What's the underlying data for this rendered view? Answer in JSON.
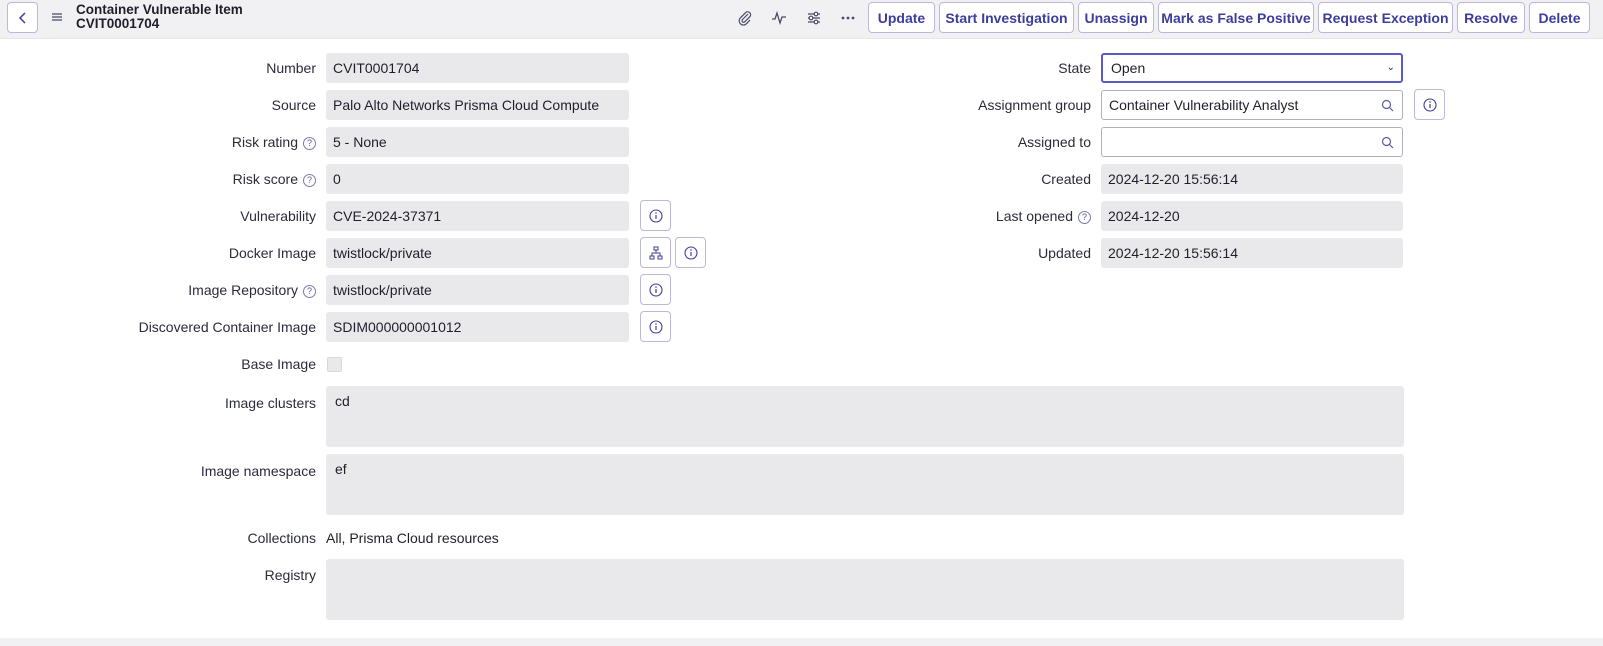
{
  "header": {
    "title": "Container Vulnerable Item",
    "number": "CVIT0001704",
    "icons": [
      "back-icon",
      "menu-icon",
      "paperclip-icon",
      "activity-icon",
      "sliders-icon",
      "more-icon"
    ],
    "buttons": {
      "update": "Update",
      "start_investigation": "Start Investigation",
      "unassign": "Unassign",
      "mark_false_positive": "Mark as False Positive",
      "request_exception": "Request Exception",
      "resolve": "Resolve",
      "delete": "Delete"
    }
  },
  "form": {
    "number": {
      "label": "Number",
      "value": "CVIT0001704"
    },
    "source": {
      "label": "Source",
      "value": "Palo Alto Networks Prisma Cloud Compute"
    },
    "risk_rating": {
      "label": "Risk rating",
      "value": "5 - None"
    },
    "risk_score": {
      "label": "Risk score",
      "value": "0"
    },
    "vulnerability": {
      "label": "Vulnerability",
      "value": "CVE-2024-37371"
    },
    "docker_image": {
      "label": "Docker Image",
      "value": "twistlock/private"
    },
    "image_repository": {
      "label": "Image Repository",
      "value": "twistlock/private"
    },
    "discovered_container_image": {
      "label": "Discovered Container Image",
      "value": "SDIM000000001012"
    },
    "base_image": {
      "label": "Base Image",
      "checked": false
    },
    "image_clusters": {
      "label": "Image clusters",
      "value": "cd"
    },
    "image_namespace": {
      "label": "Image namespace",
      "value": "ef"
    },
    "collections": {
      "label": "Collections",
      "value": "All, Prisma Cloud resources"
    },
    "registry": {
      "label": "Registry",
      "value": ""
    },
    "state": {
      "label": "State",
      "value": "Open"
    },
    "assignment_group": {
      "label": "Assignment group",
      "value": "Container Vulnerability Analyst"
    },
    "assigned_to": {
      "label": "Assigned to",
      "value": ""
    },
    "created": {
      "label": "Created",
      "value": "2024-12-20 15:56:14"
    },
    "last_opened": {
      "label": "Last opened",
      "value": "2024-12-20"
    },
    "updated": {
      "label": "Updated",
      "value": "2024-12-20 15:56:14"
    }
  },
  "colors": {
    "accent": "#3d3d9a",
    "field_bg": "#e9e9ec",
    "header_bg": "#f1f1f4",
    "border": "#b9b9d8"
  }
}
